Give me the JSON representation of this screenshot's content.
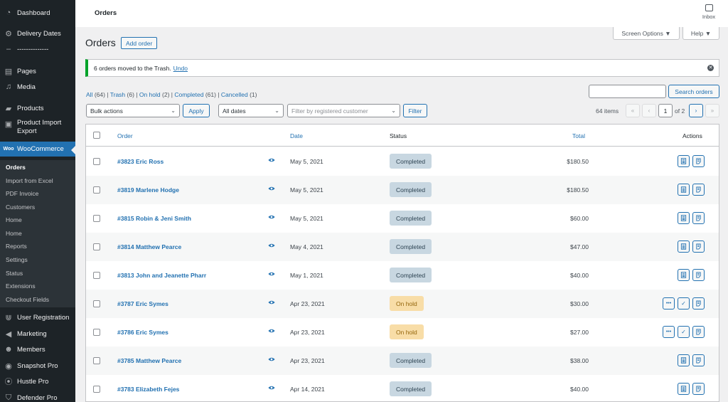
{
  "colors": {
    "sidebar_bg": "#1d2327",
    "accent": "#2271b1",
    "notice_border": "#00a32a",
    "completed_bg": "#c8d7e1",
    "completed_fg": "#2e4453",
    "onhold_bg": "#f8dda7",
    "onhold_fg": "#94660c"
  },
  "sidebar": {
    "items": [
      {
        "label": "Dashboard",
        "icon": "dashboard-icon"
      },
      {
        "label": "Delivery Dates",
        "icon": "gear-icon"
      },
      {
        "label": "--------------",
        "icon": "separator-icon"
      },
      {
        "label": "Pages",
        "icon": "pages-icon"
      },
      {
        "label": "Media",
        "icon": "media-icon"
      },
      {
        "label": "Products",
        "icon": "products-icon"
      },
      {
        "label": "Product Import Export",
        "icon": "import-export-icon"
      },
      {
        "label": "WooCommerce",
        "icon": "woo-icon"
      },
      {
        "label": "User Registration",
        "icon": "user-registration-icon"
      },
      {
        "label": "Marketing",
        "icon": "megaphone-icon"
      },
      {
        "label": "Members",
        "icon": "members-icon"
      },
      {
        "label": "Snapshot Pro",
        "icon": "snapshot-icon"
      },
      {
        "label": "Hustle Pro",
        "icon": "hustle-icon"
      },
      {
        "label": "Defender Pro",
        "icon": "shield-icon"
      }
    ],
    "submenu": [
      "Orders",
      "Import from Excel",
      "PDF Invoice",
      "Customers",
      "Home",
      "Home",
      "Reports",
      "Settings",
      "Status",
      "Extensions",
      "Checkout Fields"
    ]
  },
  "topbar": {
    "title": "Orders",
    "inbox_label": "Inbox"
  },
  "screen_options": "Screen Options ▼",
  "help": "Help ▼",
  "page": {
    "title": "Orders",
    "add_order": "Add order"
  },
  "notice": {
    "text": "6 orders moved to the Trash.",
    "undo": "Undo"
  },
  "views": [
    {
      "label": "All",
      "count": "(64)"
    },
    {
      "label": "Trash",
      "count": "(6)"
    },
    {
      "label": "On hold",
      "count": "(2)"
    },
    {
      "label": "Completed",
      "count": "(61)"
    },
    {
      "label": "Cancelled",
      "count": "(1)"
    }
  ],
  "search": {
    "button": "Search orders"
  },
  "filters": {
    "bulk_actions": "Bulk actions",
    "apply": "Apply",
    "dates": "All dates",
    "customer_placeholder": "Filter by registered customer",
    "filter": "Filter"
  },
  "pagination": {
    "items": "64 items",
    "first": "«",
    "prev": "‹",
    "current": "1",
    "of": "of 2",
    "next": "›",
    "last": "»"
  },
  "table": {
    "columns": {
      "order": "Order",
      "date": "Date",
      "status": "Status",
      "total": "Total",
      "actions": "Actions"
    },
    "rows": [
      {
        "order": "#3823 Eric Ross",
        "date": "May 5, 2021",
        "status": "Completed",
        "total": "$180.50",
        "actions": [
          "invoice",
          "packing-slip"
        ]
      },
      {
        "order": "#3819 Marlene Hodge",
        "date": "May 5, 2021",
        "status": "Completed",
        "total": "$180.50",
        "actions": [
          "invoice",
          "packing-slip"
        ]
      },
      {
        "order": "#3815 Robin & Jeni Smith",
        "date": "May 5, 2021",
        "status": "Completed",
        "total": "$60.00",
        "actions": [
          "invoice",
          "packing-slip"
        ]
      },
      {
        "order": "#3814 Matthew Pearce",
        "date": "May 4, 2021",
        "status": "Completed",
        "total": "$47.00",
        "actions": [
          "invoice",
          "packing-slip"
        ]
      },
      {
        "order": "#3813 John and Jeanette Pharr",
        "date": "May 1, 2021",
        "status": "Completed",
        "total": "$40.00",
        "actions": [
          "invoice",
          "packing-slip"
        ]
      },
      {
        "order": "#3787 Eric Symes",
        "date": "Apr 23, 2021",
        "status": "On hold",
        "total": "$30.00",
        "actions": [
          "processing",
          "complete",
          "packing-slip"
        ]
      },
      {
        "order": "#3786 Eric Symes",
        "date": "Apr 23, 2021",
        "status": "On hold",
        "total": "$27.00",
        "actions": [
          "processing",
          "complete",
          "packing-slip"
        ]
      },
      {
        "order": "#3785 Matthew Pearce",
        "date": "Apr 23, 2021",
        "status": "Completed",
        "total": "$38.00",
        "actions": [
          "invoice",
          "packing-slip"
        ]
      },
      {
        "order": "#3783 Elizabeth Fejes",
        "date": "Apr 14, 2021",
        "status": "Completed",
        "total": "$40.00",
        "actions": [
          "invoice",
          "packing-slip"
        ]
      }
    ]
  }
}
